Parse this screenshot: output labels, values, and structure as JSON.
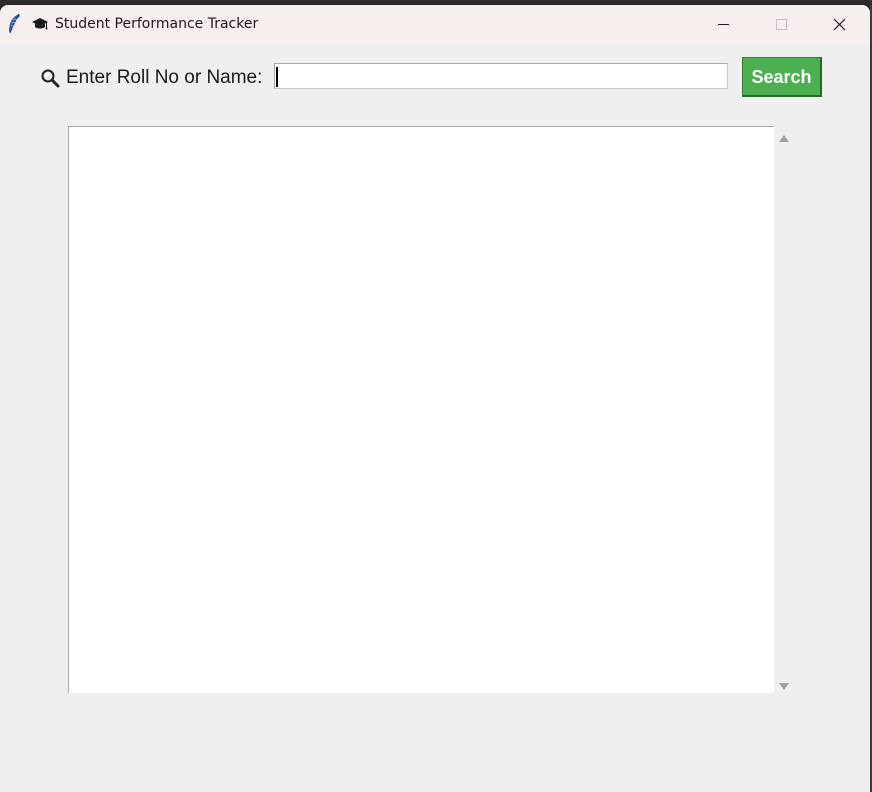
{
  "window": {
    "title": "Student Performance Tracker",
    "app_icon": "feather-icon",
    "title_icon": "graduation-cap-icon",
    "controls": {
      "minimize": "minimize-icon",
      "maximize": "maximize-icon",
      "close": "close-icon"
    }
  },
  "search": {
    "icon": "magnifier-icon",
    "label": "Enter Roll No or Name:",
    "value": "",
    "button_label": "Search",
    "button_color": "#4caf50"
  },
  "results": {
    "content": ""
  },
  "colors": {
    "titlebar": "#f7eeee",
    "background": "#efefef",
    "button": "#4caf50"
  }
}
